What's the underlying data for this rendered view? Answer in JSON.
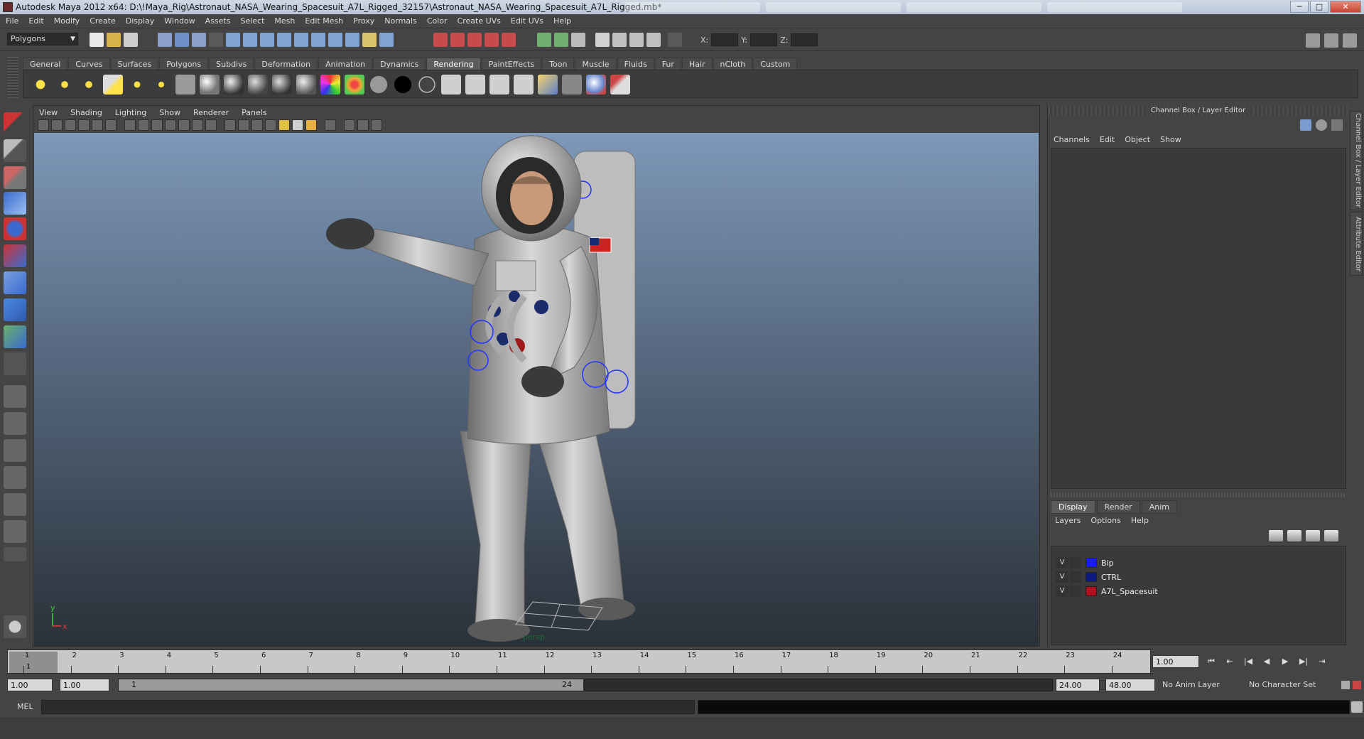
{
  "window": {
    "title": "Autodesk Maya 2012 x64: D:\\!Maya_Rig\\Astronaut_NASA_Wearing_Spacesuit_A7L_Rigged_32157\\Astronaut_NASA_Wearing_Spacesuit_A7L_Rigged.mb*",
    "minimize": "─",
    "maximize": "□",
    "close": "✕"
  },
  "menubar": [
    "File",
    "Edit",
    "Modify",
    "Create",
    "Display",
    "Window",
    "Assets",
    "Select",
    "Mesh",
    "Edit Mesh",
    "Proxy",
    "Normals",
    "Color",
    "Create UVs",
    "Edit UVs",
    "Help"
  ],
  "statusline": {
    "mode": "Polygons",
    "x_label": "X:",
    "y_label": "Y:",
    "z_label": "Z:"
  },
  "shelf": {
    "tabs": [
      "General",
      "Curves",
      "Surfaces",
      "Polygons",
      "Subdivs",
      "Deformation",
      "Animation",
      "Dynamics",
      "Rendering",
      "PaintEffects",
      "Toon",
      "Muscle",
      "Fluids",
      "Fur",
      "Hair",
      "nCloth",
      "Custom"
    ],
    "active": "Rendering"
  },
  "viewport": {
    "menu": [
      "View",
      "Shading",
      "Lighting",
      "Show",
      "Renderer",
      "Panels"
    ],
    "camera_label": "persp",
    "axis_y": "y",
    "axis_x": "x"
  },
  "channelbox": {
    "title": "Channel Box / Layer Editor",
    "menu": [
      "Channels",
      "Edit",
      "Object",
      "Show"
    ],
    "side_tabs": [
      "Channel Box / Layer Editor",
      "Attribute Editor"
    ]
  },
  "layers": {
    "tabs": [
      "Display",
      "Render",
      "Anim"
    ],
    "active_tab": "Display",
    "menu": [
      "Layers",
      "Options",
      "Help"
    ],
    "items": [
      {
        "visible": "V",
        "name": "Bip",
        "color": "#1a1aff"
      },
      {
        "visible": "V",
        "name": "CTRL",
        "color": "#0d1a80"
      },
      {
        "visible": "V",
        "name": "A7L_Spacesuit",
        "color": "#b01020"
      }
    ]
  },
  "timeslider": {
    "ticks": [
      "1",
      "2",
      "3",
      "4",
      "5",
      "6",
      "7",
      "8",
      "9",
      "10",
      "11",
      "12",
      "13",
      "14",
      "15",
      "16",
      "17",
      "18",
      "19",
      "20",
      "21",
      "22",
      "23",
      "24"
    ],
    "current_marker": "1",
    "current_frame": "1.00"
  },
  "playback": [
    "⏮",
    "⇤",
    "|◀",
    "◀",
    "▶",
    "▶|",
    "⇥"
  ],
  "rangeslider": {
    "start_time": "1.00",
    "playback_start": "1.00",
    "range_lo": "1",
    "range_hi": "24",
    "playback_end": "24.00",
    "end_time": "48.00",
    "anim_layer": "No Anim Layer",
    "character_set": "No Character Set"
  },
  "cmdline": {
    "label": "MEL"
  }
}
